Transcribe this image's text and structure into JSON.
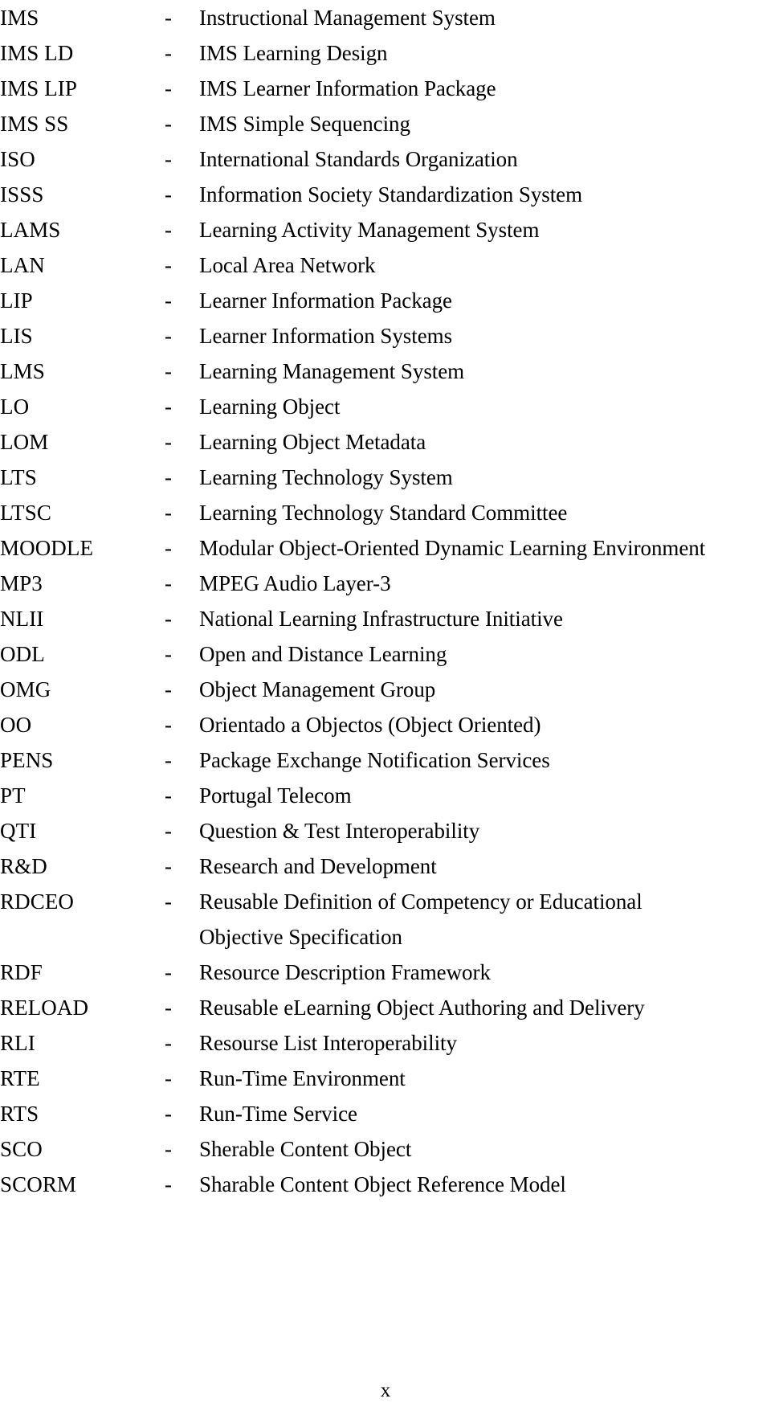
{
  "document": {
    "type": "list-of-abbreviations",
    "page_number": "x"
  },
  "separator": "-",
  "entries": [
    {
      "abbr": "IMS",
      "definition": "Instructional Management System"
    },
    {
      "abbr": "IMS LD",
      "definition": "IMS Learning Design"
    },
    {
      "abbr": "IMS LIP",
      "definition": "IMS Learner Information Package"
    },
    {
      "abbr": "IMS SS",
      "definition": "IMS Simple Sequencing"
    },
    {
      "abbr": "ISO",
      "definition": "International Standards Organization"
    },
    {
      "abbr": "ISSS",
      "definition": "Information Society Standardization System"
    },
    {
      "abbr": "LAMS",
      "definition": "Learning Activity Management System"
    },
    {
      "abbr": "LAN",
      "definition": "Local Area Network"
    },
    {
      "abbr": "LIP",
      "definition": "Learner Information Package"
    },
    {
      "abbr": "LIS",
      "definition": "Learner Information Systems"
    },
    {
      "abbr": "LMS",
      "definition": "Learning Management System"
    },
    {
      "abbr": "LO",
      "definition": "Learning Object"
    },
    {
      "abbr": "LOM",
      "definition": "Learning Object Metadata"
    },
    {
      "abbr": "LTS",
      "definition": "Learning Technology System"
    },
    {
      "abbr": "LTSC",
      "definition": "Learning Technology Standard Committee"
    },
    {
      "abbr": "MOODLE",
      "definition": "Modular Object-Oriented Dynamic Learning Environment"
    },
    {
      "abbr": "MP3",
      "definition": "MPEG Audio Layer-3"
    },
    {
      "abbr": "NLII",
      "definition": "National Learning Infrastructure Initiative"
    },
    {
      "abbr": "ODL",
      "definition": "Open and Distance Learning"
    },
    {
      "abbr": "OMG",
      "definition": "Object Management Group"
    },
    {
      "abbr": "OO",
      "definition": "Orientado a Objectos (Object Oriented)"
    },
    {
      "abbr": "PENS",
      "definition": "Package Exchange Notification Services"
    },
    {
      "abbr": "PT",
      "definition": "Portugal Telecom"
    },
    {
      "abbr": "QTI",
      "definition": "Question & Test Interoperability"
    },
    {
      "abbr": "R&D",
      "definition": "Research and Development"
    },
    {
      "abbr": "RDCEO",
      "definition": "Reusable Definition of Competency or Educational",
      "definition_line2": "Objective Specification"
    },
    {
      "abbr": "RDF",
      "definition": "Resource Description Framework"
    },
    {
      "abbr": "RELOAD",
      "definition": "Reusable eLearning Object Authoring and Delivery"
    },
    {
      "abbr": "RLI",
      "definition": "Resourse List Interoperability"
    },
    {
      "abbr": "RTE",
      "definition": "Run-Time Environment"
    },
    {
      "abbr": "RTS",
      "definition": "Run-Time Service"
    },
    {
      "abbr": "SCO",
      "definition": "Sherable Content Object"
    },
    {
      "abbr": "SCORM",
      "definition": "Sharable Content Object Reference Model"
    }
  ]
}
